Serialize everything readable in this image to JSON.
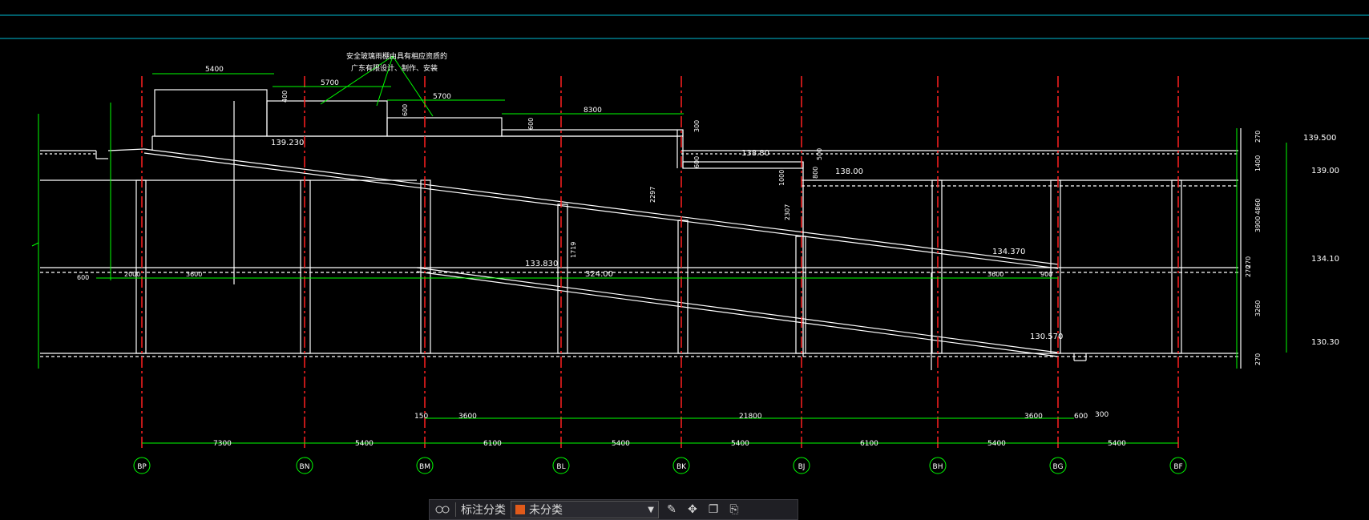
{
  "drawing": {
    "note": [
      "安全玻璃雨棚由具有相应资质的",
      "广东有限设计、制作、安装"
    ],
    "axes": [
      "BP",
      "BN",
      "BM",
      "BL",
      "BK",
      "BJ",
      "BH",
      "BG",
      "BF"
    ],
    "axis_spacing": [
      "7300",
      "5400",
      "6100",
      "5400",
      "5400",
      "6100",
      "5400",
      "5400"
    ],
    "lower_dims": [
      "150",
      "3600",
      "21800",
      "3600",
      "600",
      "300"
    ],
    "top_dims": [
      "5400",
      "5700",
      "5700",
      "8300"
    ],
    "small_dims": [
      "400",
      "600",
      "600",
      "300",
      "600",
      "500",
      "800",
      "1000",
      "2297",
      "2307",
      "1719",
      "600",
      "2000",
      "3600",
      "3600",
      "900",
      "2"
    ],
    "level_labels": [
      "139.230",
      "138.80",
      "138.00",
      "133.830",
      "324.00",
      "134.370",
      "130.570"
    ],
    "right_levels": [
      "139.500",
      "139.00",
      "134.10",
      "130.30"
    ],
    "right_dims": [
      "270",
      "1400",
      "4860",
      "3900",
      "270",
      "270",
      "3260",
      "3800",
      "270"
    ]
  },
  "toolbar": {
    "label": "标注分类",
    "select_value": "未分类",
    "swatch_color": "#e05a1a"
  },
  "colors": {
    "background": "#000000",
    "line": "#ffffff",
    "dimension": "#00ff00",
    "axis": "#ff2020",
    "frame": "#00bcd4"
  }
}
